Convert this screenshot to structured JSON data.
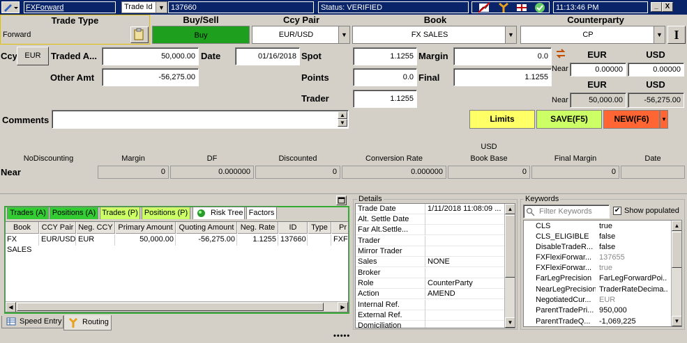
{
  "titlebar": {
    "app_menu": "FXForward",
    "id_type": "Trade Id",
    "trade_id": "137660",
    "status": "Status: VERIFIED",
    "time": "11:13:46 PM",
    "minimize": "_",
    "close": "X"
  },
  "headers": {
    "trade_type": "Trade Type",
    "buy_sell": "Buy/Sell",
    "ccy_pair": "Ccy Pair",
    "book": "Book",
    "counterparty": "Counterparty"
  },
  "trade": {
    "trade_type": "Forward",
    "buy_sell": "Buy",
    "ccy_pair": "EUR/USD",
    "book": "FX SALES",
    "counterparty": "CP",
    "ccy_label": "Ccy",
    "ccy": "EUR",
    "traded_amt_label": "Traded A...",
    "traded_amt": "50,000.00",
    "date_label": "Date",
    "date": "01/16/2018",
    "spot_label": "Spot",
    "spot": "1.1255",
    "margin_label": "Margin",
    "margin": "0.0",
    "other_amt_label": "Other Amt",
    "other_amt": "-56,275.00",
    "points_label": "Points",
    "points": "0.0",
    "final_label": "Final",
    "final": "1.1255",
    "trader_label": "Trader",
    "trader": "1.1255",
    "comments_label": "Comments",
    "comments": ""
  },
  "rates": {
    "eur": "EUR",
    "usd": "USD",
    "near_label": "Near",
    "near_eur": "0.00000",
    "near_usd": "0.00000",
    "eur2": "EUR",
    "usd2": "USD",
    "near2_label": "Near",
    "near2_eur": "50,000.00",
    "near2_usd": "-56,275.00"
  },
  "actions": {
    "limits": "Limits",
    "save": "SAVE(F5)",
    "new": "NEW(F6)"
  },
  "legs": {
    "headers": [
      "NoDiscounting",
      "Margin",
      "DF",
      "Discounted",
      "Conversion Rate",
      "Book Base",
      "Final Margin",
      "Date"
    ],
    "book_base_ccy": "USD",
    "row_label": "Near",
    "values": [
      "0",
      "0.000000",
      "0",
      "0.000000",
      "0",
      "0",
      ""
    ]
  },
  "tabs": [
    "Trades (A)",
    "Positions (A)",
    "Trades (P)",
    "Positions (P)",
    "Risk Tree",
    "Factors"
  ],
  "trades_table": {
    "columns": [
      "Book",
      "CCY Pair",
      "Neg. CCY",
      "Primary Amount",
      "Quoting Amount",
      "Neg. Rate",
      "ID",
      "Type",
      "Pr"
    ],
    "rows": [
      [
        "FX SALES",
        "EUR/USD",
        "EUR",
        "50,000.00",
        "-56,275.00",
        "1.1255",
        "137660",
        "",
        "FXFo"
      ]
    ]
  },
  "bottom_tabs": {
    "speed_entry": "Speed Entry",
    "routing": "Routing"
  },
  "details": {
    "title": "Details",
    "rows": [
      [
        "Trade Date",
        "1/11/2018 11:08:09 ..."
      ],
      [
        "Alt. Settle Date",
        ""
      ],
      [
        "Far Alt.Settle...",
        ""
      ],
      [
        "Trader",
        ""
      ],
      [
        "Mirror Trader",
        ""
      ],
      [
        "Sales",
        "NONE"
      ],
      [
        "Broker",
        ""
      ],
      [
        "Role",
        "CounterParty"
      ],
      [
        "Action",
        "AMEND"
      ],
      [
        "Internal Ref.",
        ""
      ],
      [
        "External Ref.",
        ""
      ],
      [
        "Domiciliation",
        ""
      ]
    ]
  },
  "keywords": {
    "title": "Keywords",
    "filter_placeholder": "Filter Keywords",
    "show_populated": "Show populated",
    "rows": [
      [
        "CLS",
        "true",
        false
      ],
      [
        "CLS_ELIGIBLE",
        "false",
        false
      ],
      [
        "DisableTradeR...",
        "false",
        false
      ],
      [
        "FXFlexiForwar...",
        "137655",
        true
      ],
      [
        "FXFlexiForwar...",
        "true",
        true
      ],
      [
        "FarLegPrecision",
        "FarLegForwardPoi...",
        false
      ],
      [
        "NearLegPrecision",
        "TraderRateDecima...",
        false
      ],
      [
        "NegotiatedCur...",
        "EUR",
        true
      ],
      [
        "ParentTradePri...",
        "950,000",
        false
      ],
      [
        "ParentTradeQ...",
        "-1,069,225",
        false
      ]
    ]
  },
  "colors": {
    "titlebar": "#0a246a",
    "buy": "#1ea01e",
    "limits": "#ffff66",
    "save": "#ccff66",
    "new": "#ff6633",
    "tab_green": "#33cc33",
    "tab_yellow": "#ccff66"
  }
}
